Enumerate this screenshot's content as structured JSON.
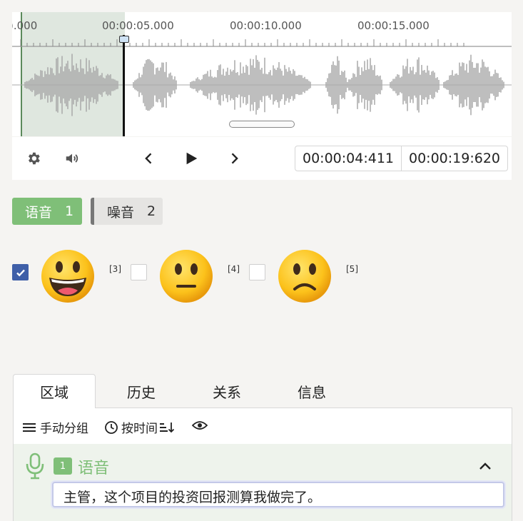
{
  "timeline": {
    "ruler_labels": [
      ").000",
      "00:00:05.000",
      "00:00:10.000",
      "00:00:15.000"
    ]
  },
  "transport": {
    "settings_icon": "gear-icon",
    "volume_icon": "speaker-icon",
    "prev_icon": "chevron-left-icon",
    "play_icon": "play-icon",
    "next_icon": "chevron-right-icon",
    "current_time": "00:00:04:411",
    "total_time": "00:00:19:620"
  },
  "labels": [
    {
      "name": "语音",
      "count": "1",
      "color": "#7fbf78"
    },
    {
      "name": "噪音",
      "count": "2",
      "color": "#777777"
    }
  ],
  "rating": {
    "options": [
      {
        "emoji": "grinning-face",
        "hotkey": "",
        "checked": true
      },
      {
        "emoji": "neutral-face",
        "hotkey": "[3]",
        "checked": false
      },
      {
        "emoji": "slightly-frowning-face",
        "hotkey": "[4]",
        "checked": false
      },
      {
        "emoji": "",
        "hotkey": "[5]",
        "checked": false
      }
    ]
  },
  "tabs": [
    "区域",
    "历史",
    "关系",
    "信息"
  ],
  "toolbar": {
    "group_label": "手动分组",
    "sort_label": "按时间"
  },
  "region": {
    "index": "1",
    "label": "语音",
    "transcript": "主管，这个项目的投资回报测算我做完了。"
  }
}
